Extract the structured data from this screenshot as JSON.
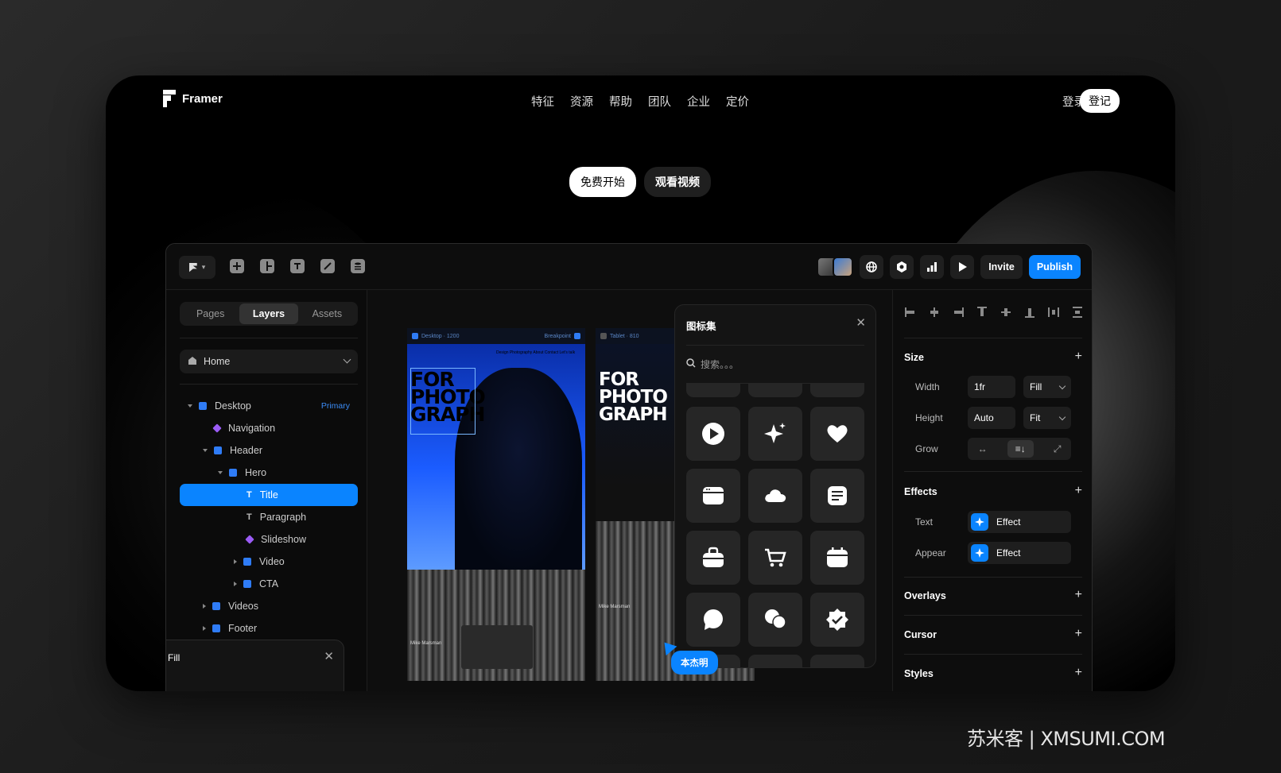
{
  "site": {
    "brand": "Framer",
    "nav": [
      "特征",
      "资源",
      "帮助",
      "团队",
      "企业",
      "定价"
    ],
    "login": "登录",
    "signup": "登记",
    "cta_primary": "免费开始",
    "cta_secondary": "观看视频"
  },
  "toolbar": {
    "invite": "Invite",
    "publish": "Publish",
    "icons": [
      "frame-icon",
      "layout-icon",
      "text-icon",
      "link-icon",
      "database-icon"
    ],
    "right_icons": [
      "globe-icon",
      "settings-icon",
      "analytics-icon",
      "play-icon"
    ]
  },
  "left": {
    "tabs": [
      "Pages",
      "Layers",
      "Assets"
    ],
    "active_tab": "Layers",
    "page_select": "Home",
    "layers": [
      {
        "label": "Desktop",
        "badge": "Primary"
      },
      {
        "label": "Navigation"
      },
      {
        "label": "Header"
      },
      {
        "label": "Hero"
      },
      {
        "label": "Title"
      },
      {
        "label": "Paragraph"
      },
      {
        "label": "Slideshow"
      },
      {
        "label": "Video"
      },
      {
        "label": "CTA"
      },
      {
        "label": "Videos"
      },
      {
        "label": "Footer"
      }
    ],
    "fill_title": "Fill"
  },
  "canvas": {
    "desktop_label": "Desktop · 1200",
    "desktop_breakpoint": "Breakpoint",
    "tablet_label": "Tablet · 810",
    "hero_text": "FOR\nPHOTO\nGRAPH",
    "nav_mini": "Design  Photography  About  Contact  Let's talk",
    "person": "Mike Marsman",
    "cursor_tag": "本杰明"
  },
  "iconset": {
    "title": "图标集",
    "search_placeholder": "搜索。。。",
    "icons": [
      "play-icon",
      "sparkle-icon",
      "heart-icon",
      "browser-icon",
      "cloud-icon",
      "document-icon",
      "bag-icon",
      "cart-icon",
      "calendar-icon",
      "chat-icon",
      "chats-icon",
      "verified-icon"
    ]
  },
  "right": {
    "sections": {
      "size": "Size",
      "effects": "Effects",
      "overlays": "Overlays",
      "cursor": "Cursor",
      "styles": "Styles"
    },
    "width_label": "Width",
    "width_value": "1fr",
    "width_mode": "Fill",
    "height_label": "Height",
    "height_value": "Auto",
    "height_mode": "Fit",
    "grow_label": "Grow",
    "text_label": "Text",
    "text_effect": "Effect",
    "appear_label": "Appear",
    "appear_effect": "Effect"
  },
  "watermark": "苏米客 | XMSUMI.COM",
  "colors": {
    "accent": "#0a84ff",
    "bg": "#000000",
    "panel": "#0d0d0d"
  }
}
